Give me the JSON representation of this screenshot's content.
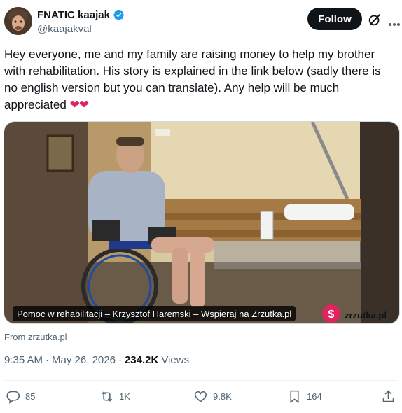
{
  "author": {
    "display_name": "FNATIC kaajak",
    "handle": "@kaajakval",
    "verified_icon": "verified-badge-icon",
    "verified_color": "#1d9bf0"
  },
  "follow_label": "Follow",
  "tweet": {
    "text": "Hey everyone, me and my family are raising money to help my brother with rehabilitation. His story is explained in the link below (sadly there is no english version but you can translate). Any help will be much appreciated",
    "emoji": "❤❤"
  },
  "link_card": {
    "title": "Pomoc w rehabilitacji – Krzysztof Haremski – Wspieraj na Zrzutka.pl",
    "logo_text": "zrzutka.pl",
    "logo_color": "#e0245e",
    "source": "From zrzutka.pl"
  },
  "meta": {
    "time": "9:35 AM",
    "separator": "·",
    "date": "May 26, 2026",
    "views_count": "234.2K",
    "views_label": "Views"
  },
  "actions": {
    "replies": "85",
    "reposts": "1K",
    "likes": "9.8K",
    "bookmarks": "164"
  }
}
